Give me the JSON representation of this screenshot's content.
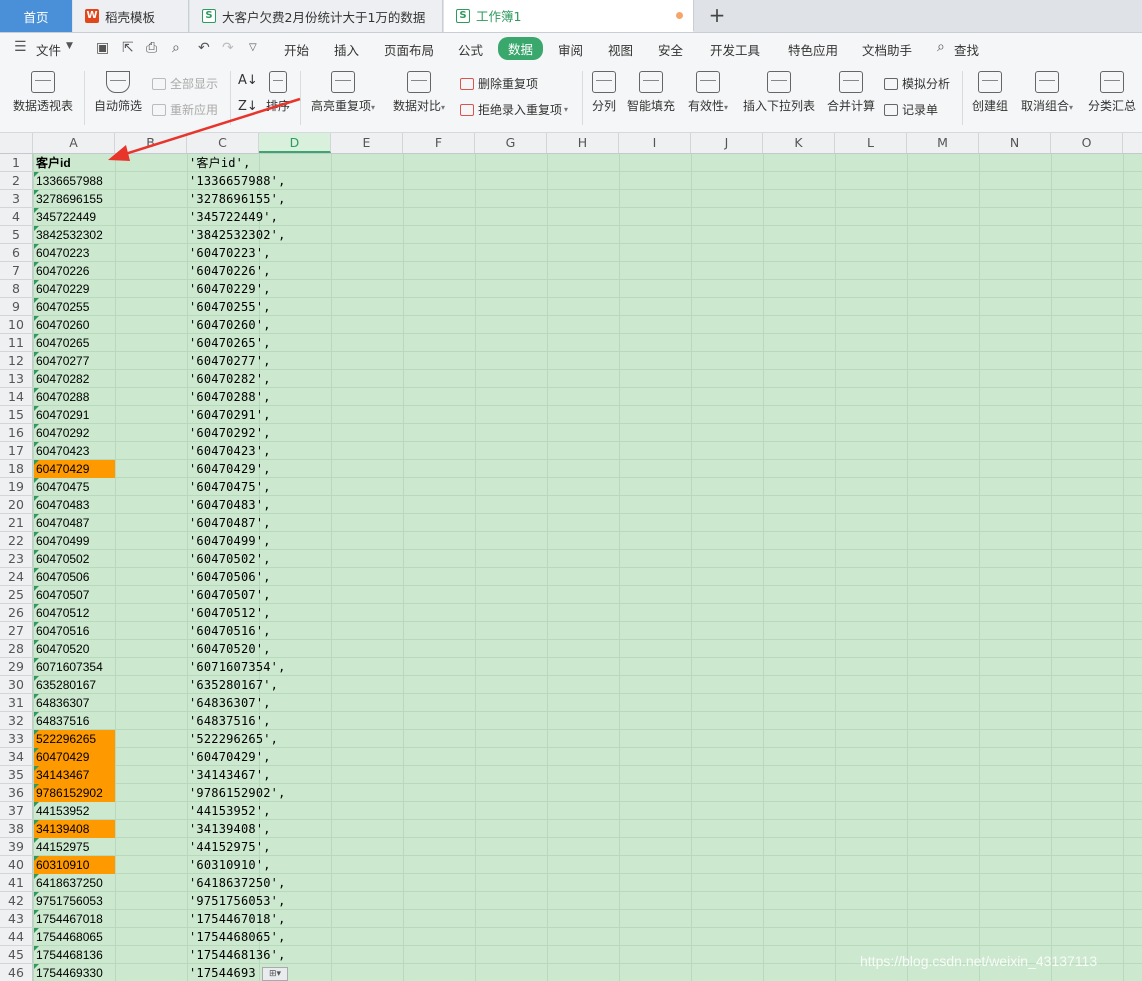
{
  "tabs": [
    {
      "label": "首页",
      "kind": "home"
    },
    {
      "label": "稻壳模板",
      "icon": "wps-icon"
    },
    {
      "label": "大客户欠费2月份统计大于1万的数据",
      "icon": "sheet-icon"
    },
    {
      "label": "工作簿1",
      "icon": "sheet-icon",
      "active": true,
      "unsaved": true
    }
  ],
  "new_tab_label": "+",
  "menu": {
    "file_label": "文件",
    "items": [
      "开始",
      "插入",
      "页面布局",
      "公式",
      "数据",
      "审阅",
      "视图",
      "安全",
      "开发工具",
      "特色应用",
      "文档助手"
    ],
    "active": "数据",
    "search_label": "查找"
  },
  "ribbon": {
    "pivot": "数据透视表",
    "autofilter": "自动筛选",
    "show_all": "全部显示",
    "reapply": "重新应用",
    "sort": "排序",
    "highlight_dup": "高亮重复项",
    "compare": "数据对比",
    "remove_dup": "删除重复项",
    "reject_dup": "拒绝录入重复项",
    "split": "分列",
    "flash_fill": "智能填充",
    "validity": "有效性",
    "insert_dropdown": "插入下拉列表",
    "consolidate": "合并计算",
    "what_if": "模拟分析",
    "form": "记录单",
    "group": "创建组",
    "ungroup": "取消组合",
    "subtotal": "分类汇总"
  },
  "columns": [
    "A",
    "B",
    "C",
    "D",
    "E",
    "F",
    "G",
    "H",
    "I",
    "J",
    "K",
    "L",
    "M",
    "N",
    "O"
  ],
  "active_column": "D",
  "rows": [
    {
      "n": "1",
      "a": "客户id",
      "c": "'客户id',",
      "hl": false,
      "bold": true
    },
    {
      "n": "2",
      "a": "1336657988",
      "c": "'1336657988',",
      "hl": false
    },
    {
      "n": "3",
      "a": "3278696155",
      "c": "'3278696155',",
      "hl": false
    },
    {
      "n": "4",
      "a": "345722449",
      "c": "'345722449',",
      "hl": false
    },
    {
      "n": "5",
      "a": "3842532302",
      "c": "'3842532302',",
      "hl": false
    },
    {
      "n": "6",
      "a": "60470223",
      "c": "'60470223',",
      "hl": false
    },
    {
      "n": "7",
      "a": "60470226",
      "c": "'60470226',",
      "hl": false
    },
    {
      "n": "8",
      "a": "60470229",
      "c": "'60470229',",
      "hl": false
    },
    {
      "n": "9",
      "a": "60470255",
      "c": "'60470255',",
      "hl": false
    },
    {
      "n": "10",
      "a": "60470260",
      "c": "'60470260',",
      "hl": false
    },
    {
      "n": "11",
      "a": "60470265",
      "c": "'60470265',",
      "hl": false
    },
    {
      "n": "12",
      "a": "60470277",
      "c": "'60470277',",
      "hl": false
    },
    {
      "n": "13",
      "a": "60470282",
      "c": "'60470282',",
      "hl": false
    },
    {
      "n": "14",
      "a": "60470288",
      "c": "'60470288',",
      "hl": false
    },
    {
      "n": "15",
      "a": "60470291",
      "c": "'60470291',",
      "hl": false
    },
    {
      "n": "16",
      "a": "60470292",
      "c": "'60470292',",
      "hl": false
    },
    {
      "n": "17",
      "a": "60470423",
      "c": "'60470423',",
      "hl": false
    },
    {
      "n": "18",
      "a": "60470429",
      "c": "'60470429',",
      "hl": true
    },
    {
      "n": "19",
      "a": "60470475",
      "c": "'60470475',",
      "hl": false
    },
    {
      "n": "20",
      "a": "60470483",
      "c": "'60470483',",
      "hl": false
    },
    {
      "n": "21",
      "a": "60470487",
      "c": "'60470487',",
      "hl": false
    },
    {
      "n": "22",
      "a": "60470499",
      "c": "'60470499',",
      "hl": false
    },
    {
      "n": "23",
      "a": "60470502",
      "c": "'60470502',",
      "hl": false
    },
    {
      "n": "24",
      "a": "60470506",
      "c": "'60470506',",
      "hl": false
    },
    {
      "n": "25",
      "a": "60470507",
      "c": "'60470507',",
      "hl": false
    },
    {
      "n": "26",
      "a": "60470512",
      "c": "'60470512',",
      "hl": false
    },
    {
      "n": "27",
      "a": "60470516",
      "c": "'60470516',",
      "hl": false
    },
    {
      "n": "28",
      "a": "60470520",
      "c": "'60470520',",
      "hl": false
    },
    {
      "n": "29",
      "a": "6071607354",
      "c": "'6071607354',",
      "hl": false
    },
    {
      "n": "30",
      "a": "635280167",
      "c": "'635280167',",
      "hl": false
    },
    {
      "n": "31",
      "a": "64836307",
      "c": "'64836307',",
      "hl": false
    },
    {
      "n": "32",
      "a": "64837516",
      "c": "'64837516',",
      "hl": false
    },
    {
      "n": "33",
      "a": "522296265",
      "c": "'522296265',",
      "hl": true
    },
    {
      "n": "34",
      "a": "60470429",
      "c": "'60470429',",
      "hl": true
    },
    {
      "n": "35",
      "a": "34143467",
      "c": "'34143467',",
      "hl": true
    },
    {
      "n": "36",
      "a": "9786152902",
      "c": "'9786152902',",
      "hl": true
    },
    {
      "n": "37",
      "a": "44153952",
      "c": "'44153952',",
      "hl": false
    },
    {
      "n": "38",
      "a": "34139408",
      "c": "'34139408',",
      "hl": true
    },
    {
      "n": "39",
      "a": "44152975",
      "c": "'44152975',",
      "hl": false
    },
    {
      "n": "40",
      "a": "60310910",
      "c": "'60310910',",
      "hl": true
    },
    {
      "n": "41",
      "a": "6418637250",
      "c": "'6418637250',",
      "hl": false
    },
    {
      "n": "42",
      "a": "9751756053",
      "c": "'9751756053',",
      "hl": false
    },
    {
      "n": "43",
      "a": "1754467018",
      "c": "'1754467018',",
      "hl": false
    },
    {
      "n": "44",
      "a": "1754468065",
      "c": "'1754468065',",
      "hl": false
    },
    {
      "n": "45",
      "a": "1754468136",
      "c": "'1754468136',",
      "hl": false
    },
    {
      "n": "46",
      "a": "1754469330",
      "c": "'17544693",
      "hl": false
    }
  ],
  "watermark": "https://blog.csdn.net/weixin_43137113",
  "colors": {
    "highlight": "#ff9900",
    "sheet_bg": "#cce8cf",
    "accent": "#3aa76d",
    "arrow": "#e8352c"
  }
}
